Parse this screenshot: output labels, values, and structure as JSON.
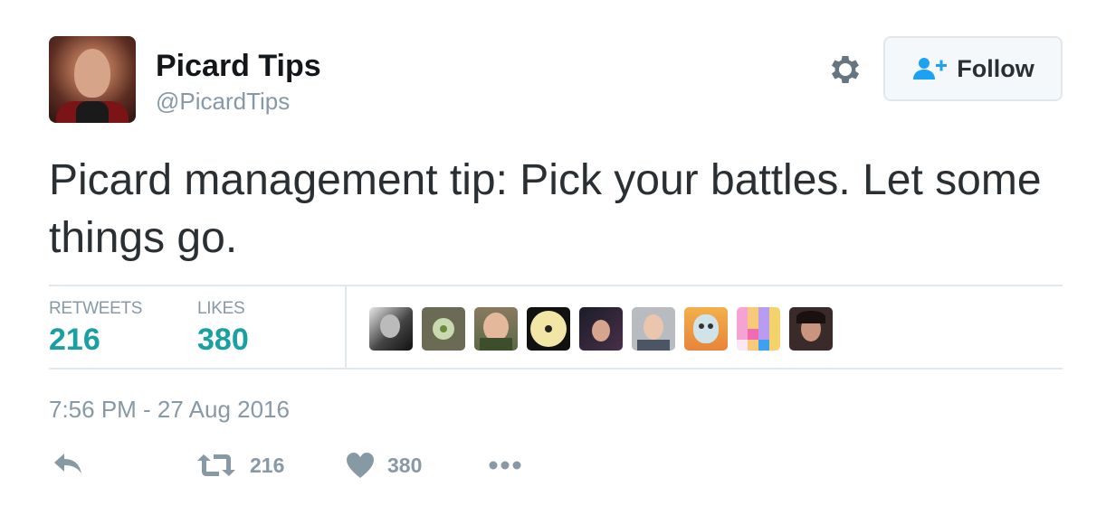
{
  "author": {
    "display_name": "Picard Tips",
    "handle": "@PicardTips"
  },
  "follow_button": {
    "label": "Follow"
  },
  "tweet": {
    "text": "Picard management tip: Pick your battles. Let some things go.",
    "timestamp": "7:56 PM - 27 Aug 2016"
  },
  "stats": {
    "retweets_label": "RETWEETS",
    "retweets_value": "216",
    "likes_label": "LIKES",
    "likes_value": "380"
  },
  "liked_by_avatars": [
    {
      "icon": "user-avatar-1"
    },
    {
      "icon": "user-avatar-2"
    },
    {
      "icon": "user-avatar-3"
    },
    {
      "icon": "user-avatar-4"
    },
    {
      "icon": "user-avatar-5"
    },
    {
      "icon": "user-avatar-6"
    },
    {
      "icon": "user-avatar-7"
    },
    {
      "icon": "user-avatar-8"
    },
    {
      "icon": "user-avatar-9"
    }
  ],
  "actions": {
    "reply_icon": "reply-icon",
    "retweet_icon": "retweet-icon",
    "retweet_count": "216",
    "like_icon": "heart-icon",
    "like_count": "380",
    "more_icon": "more-icon"
  },
  "colors": {
    "stat_value": "#19a0a0",
    "muted": "#8899a6",
    "follow_icon": "#1da1f2"
  }
}
